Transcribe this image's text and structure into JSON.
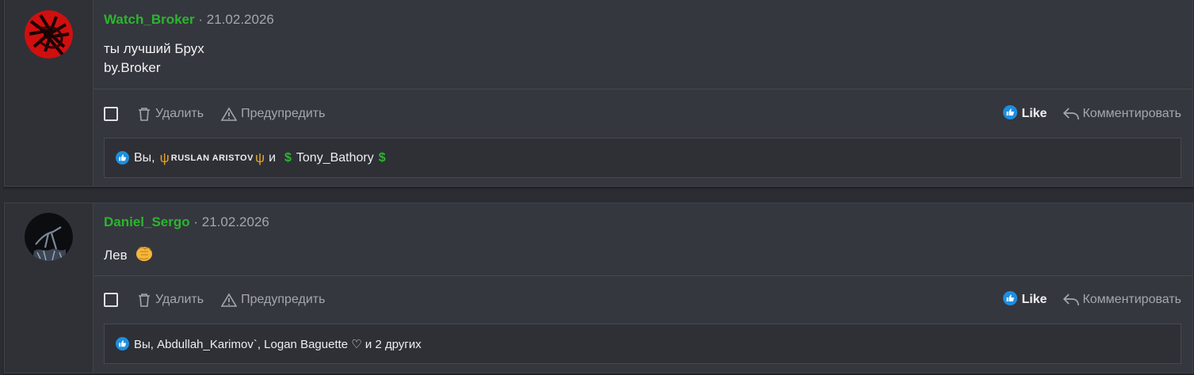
{
  "posts": [
    {
      "author": "Watch_Broker",
      "separator": "·",
      "date": "21.02.2026",
      "body_lines": [
        "ты лучший Брух",
        "by.Broker"
      ],
      "actions": {
        "delete_label": "Удалить",
        "warn_label": "Предупредить",
        "like_label": "Like",
        "comment_label": "Комментировать"
      },
      "reactions": {
        "you": "Вы,",
        "trident": "ψ",
        "user2": "RUSLAN ARISTOV",
        "and": "и",
        "dollar": "$",
        "user3": "Tony_Bathory"
      }
    },
    {
      "author": "Daniel_Sergo",
      "separator": "·",
      "date": "21.02.2026",
      "body_text": "Лев",
      "actions": {
        "delete_label": "Удалить",
        "warn_label": "Предупредить",
        "like_label": "Like",
        "comment_label": "Комментировать"
      },
      "reactions": {
        "summary": "Вы, Abdullah_Karimov`, Logan Baguette ♡ и 2 других"
      }
    }
  ],
  "colors": {
    "author": "#2bb52f",
    "like_icon": "#1d8fe0",
    "trident": "#e3a42a"
  },
  "icons": [
    "trash-icon",
    "warning-icon",
    "like-icon",
    "reply-icon",
    "fist-emoji"
  ]
}
